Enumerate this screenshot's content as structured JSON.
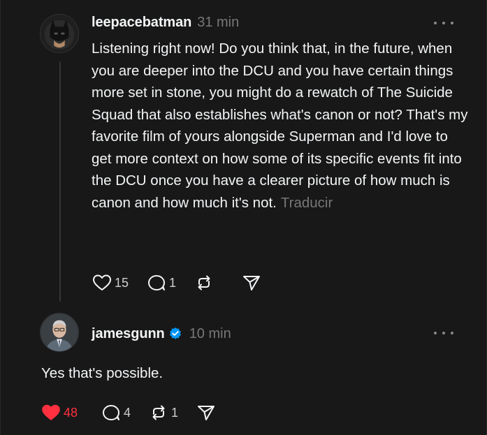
{
  "post": {
    "username": "leepacebatman",
    "time": "31 min",
    "text": "Listening right now! Do you think that, in the future, when you are deeper into the DCU and you have certain things more set in stone, you might do a rewatch of The Suicide Squad that also establishes what's canon or not? That's my favorite film of yours alongside Superman and I'd love to get more context on how some of its specific events fit into the DCU once you have a clearer picture of how much is canon and how much it's not.",
    "translate_label": "Traducir",
    "likes": "15",
    "replies": "1",
    "reposts": ""
  },
  "reply": {
    "username": "jamesgunn",
    "time": "10 min",
    "text": "Yes that's possible.",
    "likes": "48",
    "replies": "4",
    "reposts": "1"
  },
  "colors": {
    "background": "#181818",
    "text": "#f3f5f7",
    "muted": "#777777",
    "like_active": "#ff3040",
    "verified": "#0095f6"
  },
  "icons": {
    "like": "heart-icon",
    "liked": "heart-filled-icon",
    "reply": "comment-icon",
    "repost": "repost-icon",
    "share": "share-icon",
    "more": "more-icon",
    "verified": "verified-badge-icon"
  }
}
